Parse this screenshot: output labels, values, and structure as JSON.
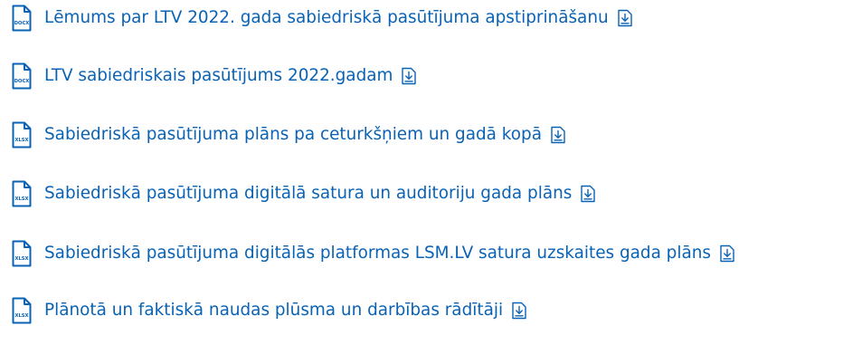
{
  "documents": [
    {
      "title": "Lēmums par LTV 2022. gada sabiedriskā pasūtījuma apstiprināšanu",
      "file_type": "DOCX",
      "icon": "docx-file-icon",
      "action_icon": "download-icon"
    },
    {
      "title": "LTV sabiedriskais pasūtījums 2022.gadam",
      "file_type": "DOCX",
      "icon": "docx-file-icon",
      "action_icon": "download-icon"
    },
    {
      "title": "Sabiedriskā pasūtījuma plāns pa ceturkšņiem un gadā kopā",
      "file_type": "XLSX",
      "icon": "xlsx-file-icon",
      "action_icon": "download-icon"
    },
    {
      "title": "Sabiedriskā pasūtījuma digitālā satura un auditoriju gada plāns",
      "file_type": "XLSX",
      "icon": "xlsx-file-icon",
      "action_icon": "download-icon"
    },
    {
      "title": "Sabiedriskā pasūtījuma digitālās platformas LSM.LV satura uzskaites gada plāns",
      "file_type": "XLSX",
      "icon": "xlsx-file-icon",
      "action_icon": "download-icon"
    },
    {
      "title": "Plānotā un faktiskā naudas plūsma un darbības rādītāji",
      "file_type": "XLSX",
      "icon": "xlsx-file-icon",
      "action_icon": "download-icon"
    }
  ],
  "colors": {
    "link": "#0a62b4",
    "icon": "#0a62b4",
    "background": "#ffffff"
  }
}
